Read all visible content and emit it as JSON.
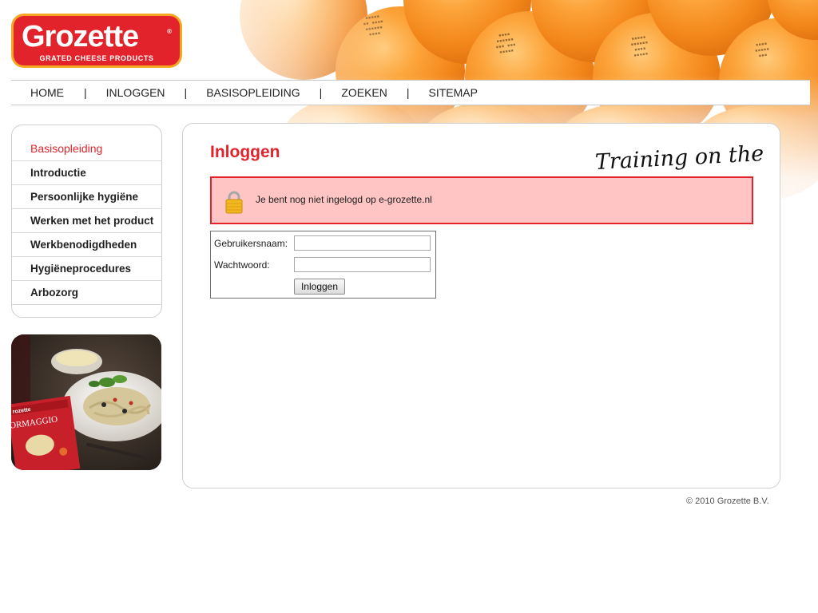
{
  "brand": {
    "name": "Grozette",
    "registered": "®",
    "subtitle": "GRATED CHEESE PRODUCTS",
    "primary_color": "#e3232b",
    "logo_border_color": "#f5a623"
  },
  "nav": {
    "items": [
      {
        "label": "HOME"
      },
      {
        "label": "INLOGGEN"
      },
      {
        "label": "BASISOPLEIDING"
      },
      {
        "label": "ZOEKEN"
      },
      {
        "label": "SITEMAP"
      }
    ],
    "separator": "|"
  },
  "sidebar": {
    "items": [
      {
        "label": "Basisopleiding",
        "active": true
      },
      {
        "label": "Introductie"
      },
      {
        "label": "Persoonlijke hygiëne"
      },
      {
        "label": "Werken met het product"
      },
      {
        "label": "Werkbenodigdheden"
      },
      {
        "label": "Hygiëneprocedures"
      },
      {
        "label": "Arbozorg"
      }
    ],
    "product_label": "ORMAGGIO"
  },
  "main": {
    "title": "Inloggen",
    "tagline": "Training on the job",
    "alert": {
      "icon": "lock-icon",
      "text": "Je bent nog niet ingelogd op e-grozette.nl",
      "background": "#ffc5c5"
    },
    "login": {
      "username_label": "Gebruikersnaam:",
      "username_value": "",
      "password_label": "Wachtwoord:",
      "password_value": "",
      "submit_label": "Inloggen"
    }
  },
  "footer": {
    "copyright": "© 2010 Grozette B.V."
  }
}
